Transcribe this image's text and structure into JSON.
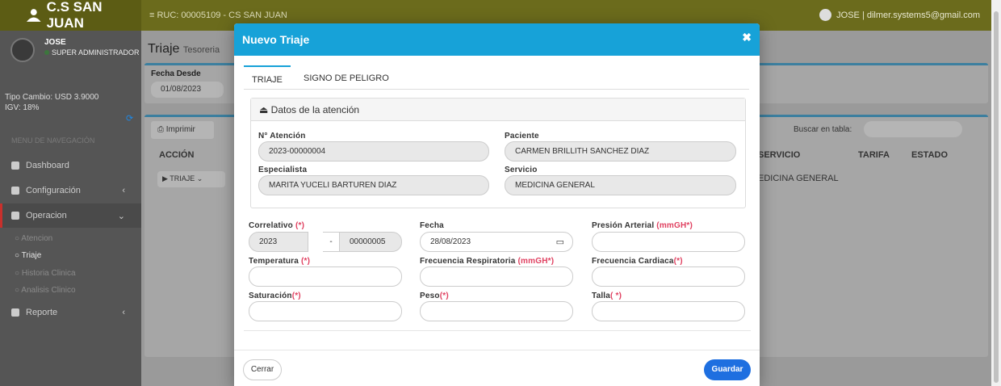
{
  "topbar": {
    "brand": "C.S SAN JUAN",
    "ruc": "≡  RUC: 00005109 - CS SAN JUAN",
    "user": "JOSE | dilmer.systems5@gmail.com"
  },
  "sidebar": {
    "user_name": "JOSE",
    "user_role": "SUPER ADMINISTRADOR",
    "tipo_cambio": "Tipo Cambio: USD 3.9000",
    "igv": "IGV: 18%",
    "nav_header": "MENU DE NAVEGACIÓN",
    "items": [
      {
        "label": "Dashboard"
      },
      {
        "label": "Configuración"
      },
      {
        "label": "Operacion"
      },
      {
        "label": "Reporte"
      }
    ],
    "subitems": [
      {
        "label": "Atencion"
      },
      {
        "label": "Triaje"
      },
      {
        "label": "Historia Clinica"
      },
      {
        "label": "Analisis Clinico"
      }
    ]
  },
  "content": {
    "title": "Triaje",
    "subtitle": "Tesoreria",
    "fecha_desde_label": "Fecha Desde",
    "fecha_desde_value": "01/08/2023",
    "imprimir_label": "Imprimir",
    "buscar_label": "Buscar en tabla:",
    "columns": [
      "ACCIÓN",
      "SERVICIO",
      "TARIFA",
      "ESTADO"
    ],
    "row": {
      "action": "TRIAJE",
      "servicio": "EDICINA GENERAL"
    }
  },
  "modal": {
    "title": "Nuevo Triaje",
    "close": "✖",
    "tabs": [
      {
        "label": "TRIAJE",
        "active": true
      },
      {
        "label": "SIGNO DE PELIGRO",
        "active": false
      }
    ],
    "datos_header": "Datos de la atención",
    "fields": {
      "n_atencion_label": "N° Atención",
      "n_atencion_value": "2023-00000004",
      "paciente_label": "Paciente",
      "paciente_value": "CARMEN BRILLITH SANCHEZ DIAZ",
      "especialista_label": "Especialista",
      "especialista_value": "MARITA YUCELI BARTUREN  DIAZ",
      "servicio_label": "Servicio",
      "servicio_value": "MEDICINA GENERAL",
      "correlativo_label": "Correlativo",
      "correlativo_req": "(*)",
      "correlativo_year": "2023",
      "correlativo_sep": "-",
      "correlativo_num": "00000005",
      "fecha_label": "Fecha",
      "fecha_value": "28/08/2023",
      "presion_label": "Presión Arterial",
      "presion_unit": "(mmGH*)",
      "temperatura_label": "Temperatura",
      "temperatura_req": "(*)",
      "frec_resp_label": "Frecuencia Respiratoria",
      "frec_resp_unit": "(mmGH*)",
      "frec_card_label": "Frecuencia Cardiaca",
      "frec_card_req": "(*)",
      "saturacion_label": "Saturación",
      "saturacion_req": "(*)",
      "peso_label": "Peso",
      "peso_req": "(*)",
      "talla_label": "Talla",
      "talla_req": "( *)"
    },
    "cerrar_label": "Cerrar",
    "guardar_label": "Guardar"
  },
  "colors": {
    "modal_header": "#17a2d8",
    "guardar": "#1e6fe0",
    "required": "#e04060"
  }
}
